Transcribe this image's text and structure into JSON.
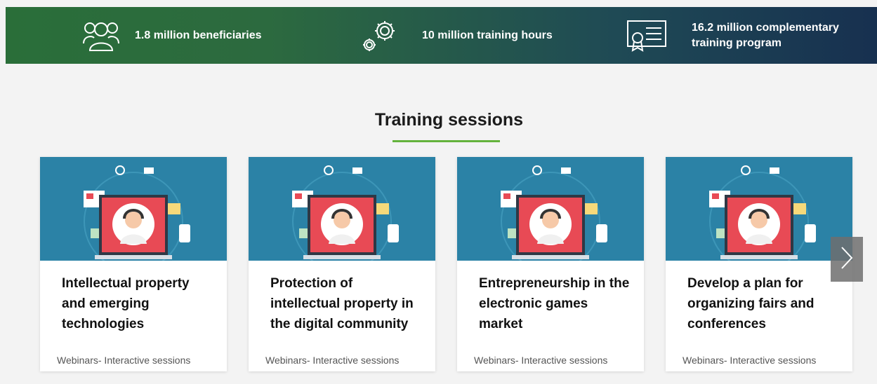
{
  "stats": [
    {
      "icon": "users-icon",
      "text": "1.8 million beneficiaries"
    },
    {
      "icon": "gears-icon",
      "text": "10  million training hours"
    },
    {
      "icon": "certificate-icon",
      "text": "16.2 million complementary training program"
    }
  ],
  "section": {
    "title": "Training sessions"
  },
  "cards": [
    {
      "title": "Intellectual property and emerging technologies",
      "type": "Webinars- Interactive sessions"
    },
    {
      "title": "Protection of intellectual property in the digital community",
      "type": "Webinars- Interactive sessions"
    },
    {
      "title": "Entrepreneurship in the electronic games market",
      "type": "Webinars- Interactive sessions"
    },
    {
      "title": "Develop a plan for organizing fairs and conferences",
      "type": "Webinars- Interactive sessions"
    }
  ],
  "carousel": {
    "next_icon": "chevron-right-icon"
  },
  "colors": {
    "accent_underline": "#64b33c",
    "thumb_bg": "#2b82a6",
    "screen_red": "#e84a55"
  }
}
